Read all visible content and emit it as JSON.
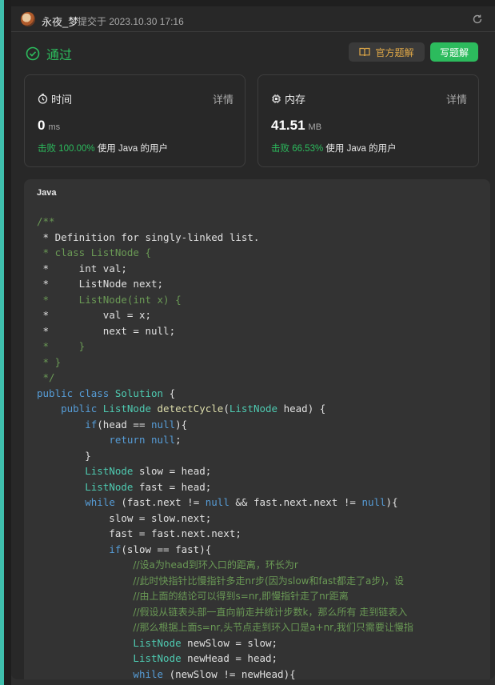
{
  "header": {
    "username": "永夜_梦",
    "submitted": "提交于 2023.10.30 17:16"
  },
  "status": {
    "label": "通过"
  },
  "buttons": {
    "official_solution": "官方题解",
    "write_solution": "写题解"
  },
  "runtime": {
    "title": "时间",
    "detail": "详情",
    "value": "0",
    "unit": "ms",
    "beats_pct": "击败 100.00%",
    "beats_suffix": "使用 Java 的用户"
  },
  "memory": {
    "title": "内存",
    "detail": "详情",
    "value": "41.51",
    "unit": "MB",
    "beats_pct": "击败 66.53%",
    "beats_suffix": "使用 Java 的用户"
  },
  "code_block": {
    "language": "Java",
    "lines": [
      [
        [
          "c",
          "/**"
        ]
      ],
      [
        [
          "c",
          " "
        ],
        [
          "p",
          "* Definition for singly-linked list."
        ]
      ],
      [
        [
          "c",
          " * class ListNode {"
        ]
      ],
      [
        [
          "c",
          " "
        ],
        [
          "p",
          "*     int val;"
        ]
      ],
      [
        [
          "c",
          " "
        ],
        [
          "p",
          "*     ListNode next;"
        ]
      ],
      [
        [
          "c",
          " *     ListNode(int x) {"
        ]
      ],
      [
        [
          "c",
          " "
        ],
        [
          "p",
          "*         val = x;"
        ]
      ],
      [
        [
          "c",
          " "
        ],
        [
          "p",
          "*         next = null;"
        ]
      ],
      [
        [
          "c",
          " *     }"
        ]
      ],
      [
        [
          "c",
          " * }"
        ]
      ],
      [
        [
          "c",
          " */"
        ]
      ],
      [
        [
          "k",
          "public class "
        ],
        [
          "t",
          "Solution"
        ],
        [
          "p",
          " {"
        ]
      ],
      [
        [
          "p",
          "    "
        ],
        [
          "k",
          "public "
        ],
        [
          "t",
          "ListNode "
        ],
        [
          "f",
          "detectCycle"
        ],
        [
          "p",
          "("
        ],
        [
          "t",
          "ListNode"
        ],
        [
          "p",
          " head) {"
        ]
      ],
      [
        [
          "p",
          "        "
        ],
        [
          "k",
          "if"
        ],
        [
          "p",
          "(head == "
        ],
        [
          "k",
          "null"
        ],
        [
          "p",
          "){"
        ]
      ],
      [
        [
          "p",
          "            "
        ],
        [
          "k",
          "return null"
        ],
        [
          "p",
          ";"
        ]
      ],
      [
        [
          "p",
          "        }"
        ]
      ],
      [
        [
          "p",
          "        "
        ],
        [
          "t",
          "ListNode"
        ],
        [
          "p",
          " slow = head;"
        ]
      ],
      [
        [
          "p",
          "        "
        ],
        [
          "t",
          "ListNode"
        ],
        [
          "p",
          " fast = head;"
        ]
      ],
      [
        [
          "p",
          "        "
        ],
        [
          "k",
          "while"
        ],
        [
          "p",
          " (fast.next != "
        ],
        [
          "k",
          "null"
        ],
        [
          "p",
          " && fast.next.next != "
        ],
        [
          "k",
          "null"
        ],
        [
          "p",
          "){"
        ]
      ],
      [
        [
          "p",
          "            slow = slow.next;"
        ]
      ],
      [
        [
          "p",
          "            fast = fast.next.next;"
        ]
      ],
      [
        [
          "p",
          "            "
        ],
        [
          "k",
          "if"
        ],
        [
          "p",
          "(slow == fast){"
        ]
      ],
      [
        [
          "p",
          "                "
        ],
        [
          "c",
          "//设a为head到环入口的距离，环长为r"
        ]
      ],
      [
        [
          "p",
          "                "
        ],
        [
          "c",
          "//此时快指针比慢指针多走nr步(因为slow和fast都走了a步)，设"
        ]
      ],
      [
        [
          "p",
          "                "
        ],
        [
          "c",
          "//由上面的结论可以得到s=nr,即慢指针走了nr距离"
        ]
      ],
      [
        [
          "p",
          "                "
        ],
        [
          "c",
          "//假设从链表头部一直向前走并统计步数k，那么所有 走到链表入"
        ]
      ],
      [
        [
          "p",
          "                "
        ],
        [
          "c",
          "//那么根据上面s=nr,头节点走到环入口是a+nr,我们只需要让慢指"
        ]
      ],
      [
        [
          "p",
          "                "
        ],
        [
          "t",
          "ListNode"
        ],
        [
          "p",
          " newSlow = slow;"
        ]
      ],
      [
        [
          "p",
          "                "
        ],
        [
          "t",
          "ListNode"
        ],
        [
          "p",
          " newHead = head;"
        ]
      ],
      [
        [
          "p",
          "                "
        ],
        [
          "k",
          "while"
        ],
        [
          "p",
          " (newSlow != newHead){"
        ]
      ]
    ]
  },
  "colors": {
    "accept_green": "#2cbb5d",
    "solution_orange": "#e0a847",
    "keyword": "#569cd6",
    "type": "#4ec9b0",
    "comment": "#6a9955",
    "function": "#dcdcaa"
  },
  "icons": [
    "refresh-icon",
    "check-circle-icon",
    "book-icon",
    "clock-icon",
    "chip-icon"
  ]
}
